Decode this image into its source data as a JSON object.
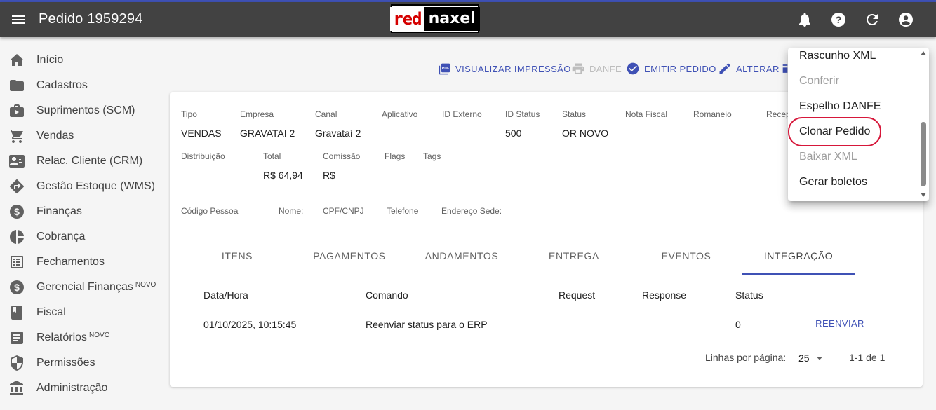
{
  "appbar": {
    "title": "Pedido 1959294",
    "logo_left": "red",
    "logo_right": "naxel",
    "icons": [
      "menu-icon",
      "bell-icon",
      "help-icon",
      "refresh-icon",
      "account-icon"
    ]
  },
  "sidebar": {
    "items": [
      {
        "label": "Início",
        "icon": "home-icon"
      },
      {
        "label": "Cadastros",
        "icon": "folder-icon"
      },
      {
        "label": "Suprimentos (SCM)",
        "icon": "briefcase-icon"
      },
      {
        "label": "Vendas",
        "icon": "cart-icon"
      },
      {
        "label": "Relac. Cliente (CRM)",
        "icon": "contact-card-icon"
      },
      {
        "label": "Gestão Estoque (WMS)",
        "icon": "directions-icon"
      },
      {
        "label": "Finanças",
        "icon": "dollar-icon"
      },
      {
        "label": "Cobrança",
        "icon": "pie-chart-icon"
      },
      {
        "label": "Fechamentos",
        "icon": "list-alt-icon"
      },
      {
        "label": "Gerencial Finanças",
        "icon": "dollar-icon",
        "badge": "NOVO"
      },
      {
        "label": "Fiscal",
        "icon": "book-icon"
      },
      {
        "label": "Relatórios",
        "icon": "article-icon",
        "badge": "NOVO"
      },
      {
        "label": "Permissões",
        "icon": "shield-icon"
      },
      {
        "label": "Administração",
        "icon": "bank-icon"
      }
    ]
  },
  "toolbar": {
    "visualizar": "VISUALIZAR IMPRESSÃO",
    "danfe": "DANFE",
    "emitir": "EMITIR PEDIDO",
    "alterar": "ALTERAR"
  },
  "order": {
    "labels": {
      "tipo": "Tipo",
      "empresa": "Empresa",
      "canal": "Canal",
      "aplicativo": "Aplicativo",
      "id_externo": "ID Externo",
      "id_status": "ID Status",
      "status": "Status",
      "nota_fiscal": "Nota Fiscal",
      "romaneio": "Romaneio",
      "recep": "Recep",
      "distribuicao": "Distribuição",
      "total": "Total",
      "comissao": "Comissão",
      "flags": "Flags",
      "tags": "Tags"
    },
    "values": {
      "tipo": "VENDAS",
      "empresa": "GRAVATAI 2",
      "canal": "Gravataí 2",
      "id_status": "500",
      "status": "OR NOVO",
      "total": "R$ 64,94",
      "comissao": "R$"
    }
  },
  "person": {
    "codigo": "Código Pessoa",
    "nome": "Nome:",
    "cpf": "CPF/CNPJ",
    "telefone": "Telefone",
    "endereco": "Endereço Sede:"
  },
  "tabs": [
    "ITENS",
    "PAGAMENTOS",
    "ANDAMENTOS",
    "ENTREGA",
    "EVENTOS",
    "INTEGRAÇÃO"
  ],
  "table": {
    "headers": [
      "Data/Hora",
      "Comando",
      "Request",
      "Response",
      "Status"
    ],
    "rows": [
      {
        "datahora": "01/10/2025, 10:15:45",
        "comando": "Reenviar status para o ERP",
        "status": "0",
        "action": "REENVIAR"
      }
    ]
  },
  "pagination": {
    "label": "Linhas por página:",
    "per_page": "25",
    "range": "1-1 de 1"
  },
  "dropdown": {
    "items": [
      {
        "label": "Rascunho XML",
        "disabled": false
      },
      {
        "label": "Conferir",
        "disabled": true
      },
      {
        "label": "Espelho DANFE",
        "disabled": false
      },
      {
        "label": "Clonar Pedido",
        "disabled": false
      },
      {
        "label": "Baixar XML",
        "disabled": true
      },
      {
        "label": "Gerar boletos",
        "disabled": false
      }
    ]
  },
  "colors": {
    "appbar": "#424242",
    "accent": "#3f51b5",
    "highlight": "#d6173a"
  }
}
